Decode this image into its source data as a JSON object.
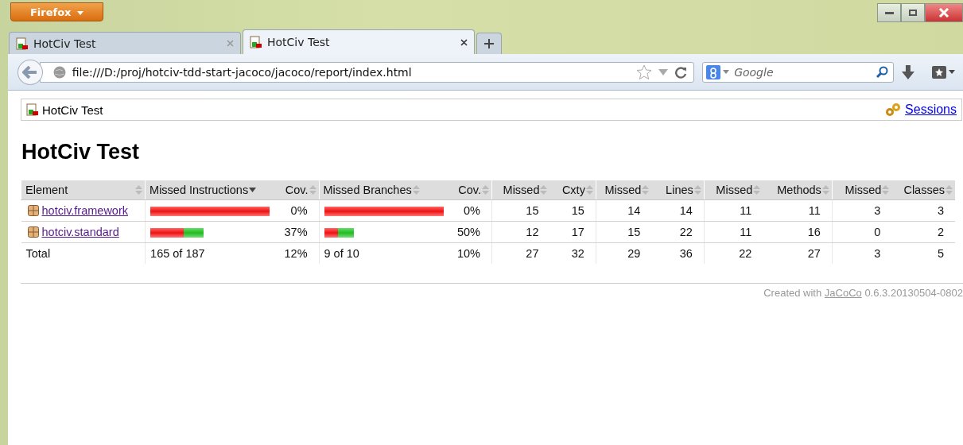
{
  "browser": {
    "menu_button": "Firefox",
    "tabs": [
      {
        "title": "HotCiv Test",
        "selected": false
      },
      {
        "title": "HotCiv Test",
        "selected": true
      }
    ],
    "address": "file:///D:/proj/hotciv-tdd-start-jacoco/jacoco/report/index.html",
    "search": {
      "placeholder": "Google"
    }
  },
  "breadcrumb": {
    "label": "HotCiv Test",
    "sessions_link": "Sessions"
  },
  "heading": "HotCiv Test",
  "table": {
    "columns": [
      {
        "label": "Element",
        "sorted": false
      },
      {
        "label": "Missed Instructions",
        "sorted": true
      },
      {
        "label": "Cov.",
        "sorted": false
      },
      {
        "label": "Missed Branches",
        "sorted": false
      },
      {
        "label": "Cov.",
        "sorted": false
      },
      {
        "label": "Missed",
        "sorted": false
      },
      {
        "label": "Cxty",
        "sorted": false
      },
      {
        "label": "Missed",
        "sorted": false
      },
      {
        "label": "Lines",
        "sorted": false
      },
      {
        "label": "Missed",
        "sorted": false
      },
      {
        "label": "Methods",
        "sorted": false
      },
      {
        "label": "Missed",
        "sorted": false
      },
      {
        "label": "Classes",
        "sorted": false
      }
    ],
    "rows": [
      {
        "kind": "package",
        "element": "hotciv.framework",
        "instructions_bar": {
          "kind": "missed_only"
        },
        "instructions_cov": "0%",
        "branches_bar": {
          "kind": "missed_only"
        },
        "branches_cov": "0%",
        "counts": [
          "15",
          "15",
          "14",
          "14",
          "11",
          "11",
          "3",
          "3"
        ]
      },
      {
        "kind": "package",
        "element": "hotciv.standard",
        "instructions_bar": {
          "kind": "split",
          "missed": {
            "level": 0.63
          }
        },
        "instructions_cov": "37%",
        "branches_bar": {
          "kind": "split",
          "missed": {
            "level": 0.46
          }
        },
        "branches_cov": "50%",
        "counts": [
          "12",
          "17",
          "15",
          "22",
          "11",
          "16",
          "0",
          "2"
        ]
      },
      {
        "kind": "total",
        "element": "Total",
        "instructions_text": "165 of 187",
        "instructions_cov": "12%",
        "branches_text": "9 of 10",
        "branches_cov": "10%",
        "counts": [
          "27",
          "32",
          "29",
          "36",
          "22",
          "27",
          "3",
          "5"
        ]
      }
    ]
  },
  "footer": {
    "prefix": "Created with",
    "link": "JaCoCo",
    "version": "0.6.3.20130504-0802"
  }
}
